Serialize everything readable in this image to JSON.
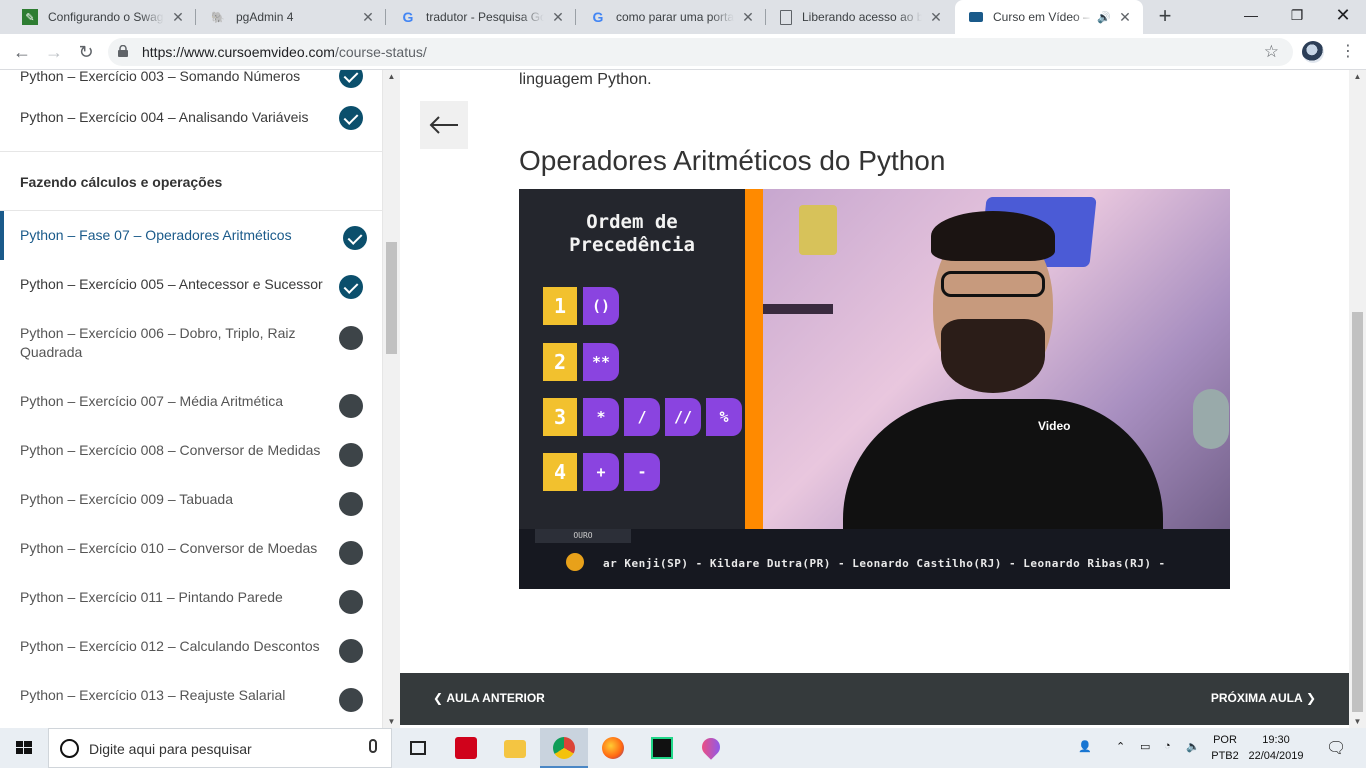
{
  "browser": {
    "tabs": [
      {
        "title": "Configurando o Swagger",
        "favicon_color": "#2e7d32",
        "active": false
      },
      {
        "title": "pgAdmin 4",
        "favicon_color": "#336791",
        "active": false
      },
      {
        "title": "tradutor - Pesquisa Google",
        "favicon_color": "#4285f4",
        "active": false
      },
      {
        "title": "como parar uma porta",
        "favicon_color": "#4285f4",
        "active": false
      },
      {
        "title": "Liberando acesso ao banco",
        "favicon_color": "#5f6368",
        "active": false
      },
      {
        "title": "Curso em Vídeo – Curso",
        "favicon_color": "#1a5a8a",
        "active": true
      }
    ],
    "url_host": "https://www.cursoemvideo.com",
    "url_path": "/course-status/"
  },
  "sidebar": {
    "top_cut_label": "Python – Exercício 003 – Somando Números",
    "first_item": {
      "label": "Python – Exercício 004 – Analisando Variáveis",
      "done": true
    },
    "section_title": "Fazendo cálculos e operações",
    "items": [
      {
        "label": "Python – Fase 07 – Operadores Aritméticos",
        "done": true,
        "active": true
      },
      {
        "label": "Python – Exercício 005 – Antecessor e Sucessor",
        "done": true,
        "active": false
      },
      {
        "label": "Python – Exercício 006 – Dobro, Triplo, Raiz Quadrada",
        "done": false,
        "active": false
      },
      {
        "label": "Python – Exercício 007 – Média Aritmética",
        "done": false,
        "active": false
      },
      {
        "label": "Python – Exercício 008 – Conversor de Medidas",
        "done": false,
        "active": false
      },
      {
        "label": "Python – Exercício 009 – Tabuada",
        "done": false,
        "active": false
      },
      {
        "label": "Python – Exercício 010 – Conversor de Moedas",
        "done": false,
        "active": false
      },
      {
        "label": "Python – Exercício 011 – Pintando Parede",
        "done": false,
        "active": false
      },
      {
        "label": "Python – Exercício 012 – Calculando Descontos",
        "done": false,
        "active": false
      },
      {
        "label": "Python – Exercício 013 – Reajuste Salarial",
        "done": false,
        "active": false
      }
    ]
  },
  "main": {
    "intro_text": "linguagem Python.",
    "lesson_title": "Operadores Aritméticos do Python",
    "video": {
      "board_title_line1": "Ordem de",
      "board_title_line2": "Precedência",
      "precedence": [
        {
          "num": "1",
          "ops": [
            "()"
          ]
        },
        {
          "num": "2",
          "ops": [
            "**"
          ]
        },
        {
          "num": "3",
          "ops": [
            "*",
            "/",
            "//",
            "%"
          ]
        },
        {
          "num": "4",
          "ops": [
            "+",
            "-"
          ]
        }
      ],
      "ticker_badge": "OURO",
      "ticker_names": "ar Kenji(SP) - Kildare Dutra(PR) - Leonardo Castilho(RJ) - Leonardo Ribas(RJ) -",
      "shirt_logo": "Video"
    },
    "prev_label": "AULA ANTERIOR",
    "next_label": "PRÓXIMA AULA"
  },
  "taskbar": {
    "search_placeholder": "Digite aqui para pesquisar",
    "lang_line1": "POR",
    "lang_line2": "PTB2",
    "time": "19:30",
    "date": "22/04/2019"
  }
}
